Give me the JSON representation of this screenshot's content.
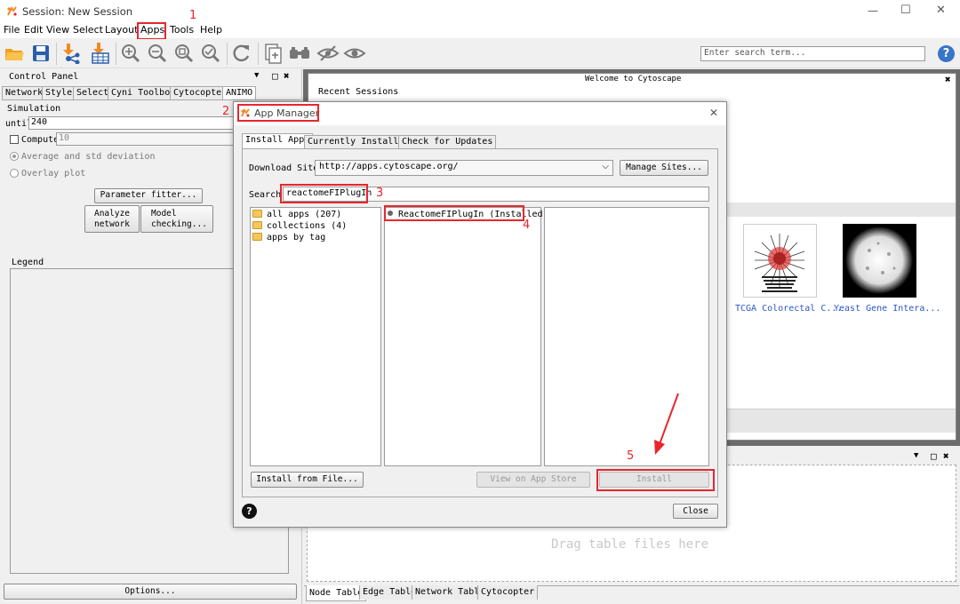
{
  "window": {
    "title": "Session: New Session",
    "controls": [
      "—",
      "☐",
      "✕"
    ]
  },
  "menu": [
    "File",
    "Edit",
    "View",
    "Select",
    "Layout",
    "Apps",
    "Tools",
    "Help"
  ],
  "toolbar": {
    "search_placeholder": "Enter search term...",
    "help": "?"
  },
  "annotations": [
    "1",
    "2",
    "3",
    "4",
    "5"
  ],
  "control_panel": {
    "title": "Control Panel",
    "header_icons": [
      "▼",
      "□",
      "✖"
    ],
    "tabs": [
      "Network",
      "Style",
      "Select",
      "Cyni Toolbox",
      "Cytocopter",
      "ANIMO"
    ],
    "simulation": "Simulation",
    "until_label": "until",
    "until_value": "240",
    "compute_label": "Compute",
    "compute_value": "10",
    "radio1": "Average and std deviation",
    "radio2": "Overlay plot",
    "param_fitter": "Parameter fitter...",
    "analyze_btn": [
      "Analyze",
      "network"
    ],
    "model_btn": [
      "Model",
      "checking..."
    ],
    "legend": "Legend",
    "options": "Options..."
  },
  "welcome": {
    "title": "Welcome to Cytoscape",
    "close": "✖",
    "recent": "Recent Sessions",
    "thumb1": "TCGA Colorectal C...",
    "thumb2": "Yeast Gene Intera..."
  },
  "table_panel": {
    "header_icons": [
      "▼",
      "□",
      "✖"
    ],
    "drop_text": "Drag table files here",
    "tabs": [
      "Node Table",
      "Edge Table",
      "Network Table",
      "Cytocopter"
    ]
  },
  "dialog": {
    "title": "App Manager",
    "close": "✕",
    "tabs": [
      "Install Apps",
      "Currently Installed",
      "Check for Updates"
    ],
    "download_label": "Download Site:",
    "download_value": "http://apps.cytoscape.org/",
    "manage_sites": "Manage Sites...",
    "search_label": "Search:",
    "search_value": "reactomeFIPlugIn",
    "categories": [
      "all apps (207)",
      "collections (4)",
      "apps by tag"
    ],
    "result": "ReactomeFIPlugIn (Installed",
    "install_from_file": "Install from File...",
    "view_store": "View on App Store",
    "install": "Install",
    "help": "?",
    "close_btn": "Close"
  }
}
